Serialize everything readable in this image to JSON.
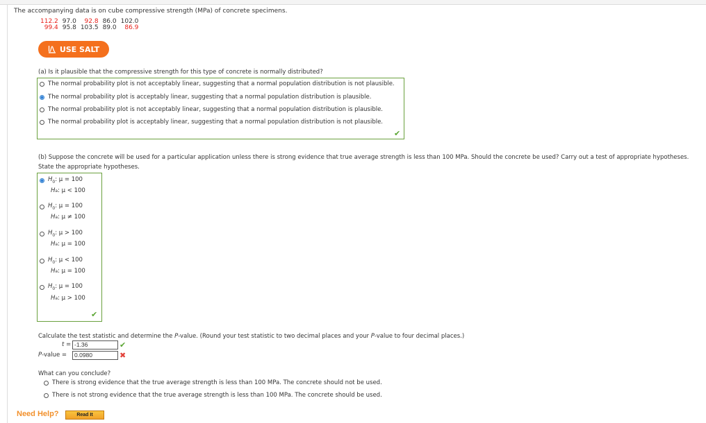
{
  "intro": "The accompanying data is on cube compressive strength (MPa) of concrete specimens.",
  "data_table": {
    "rows": [
      [
        {
          "v": "112.2",
          "c": "red"
        },
        {
          "v": "97.0",
          "c": "blk"
        },
        {
          "v": "92.8",
          "c": "red"
        },
        {
          "v": "86.0",
          "c": "blk"
        },
        {
          "v": "102.0",
          "c": "blk"
        }
      ],
      [
        {
          "v": "99.4",
          "c": "red"
        },
        {
          "v": "95.8",
          "c": "blk"
        },
        {
          "v": "103.5",
          "c": "blk"
        },
        {
          "v": "89.0",
          "c": "blk"
        },
        {
          "v": "86.9",
          "c": "red"
        }
      ]
    ]
  },
  "salt_button": {
    "label": "USE SALT",
    "icon": "salt-distribution-icon"
  },
  "part_a": {
    "question": "(a) Is it plausible that the compressive strength for this type of concrete is normally distributed?",
    "options": [
      {
        "label": "The normal probability plot is not acceptably linear, suggesting that a normal population distribution is not plausible.",
        "selected": false
      },
      {
        "label": "The normal probability plot is acceptably linear, suggesting that a normal population distribution is plausible.",
        "selected": true
      },
      {
        "label": "The normal probability plot is not acceptably linear, suggesting that a normal population distribution is plausible.",
        "selected": false
      },
      {
        "label": "The normal probability plot is acceptably linear, suggesting that a normal population distribution is not plausible.",
        "selected": false
      }
    ],
    "status": "correct"
  },
  "part_b": {
    "question": "(b) Suppose the concrete will be used for a particular application unless there is strong evidence that true average strength is less than 100 MPa. Should the concrete be used? Carry out a test of appropriate hypotheses.",
    "prompt": "State the appropriate hypotheses.",
    "hypotheses": [
      {
        "h0": ": μ = 100",
        "ha": ": μ < 100",
        "selected": true
      },
      {
        "h0": ": μ = 100",
        "ha": ": μ ≠ 100",
        "selected": false
      },
      {
        "h0": ": μ > 100",
        "ha": ": μ = 100",
        "selected": false
      },
      {
        "h0": ": μ < 100",
        "ha": ": μ = 100",
        "selected": false
      },
      {
        "h0": ": μ = 100",
        "ha": ": μ > 100",
        "selected": false
      }
    ],
    "h0_label": "H",
    "h0_sub": "0",
    "ha_label": "H",
    "ha_sub": "a",
    "status": "correct"
  },
  "calc": {
    "prompt_pre": "Calculate the test statistic and determine the ",
    "prompt_p": "P",
    "prompt_post": "-value. (Round your test statistic to two decimal places and your ",
    "prompt_p2": "P",
    "prompt_post2": "-value to four decimal places.)",
    "t_label": "t",
    "eq": " = ",
    "t_value": "-1.36",
    "t_status": "correct",
    "p_label_i": "P",
    "p_label": "-value",
    "p_value": "0.0980",
    "p_status": "incorrect"
  },
  "conclude": {
    "question": "What can you conclude?",
    "options": [
      {
        "label": "There is strong evidence that the true average strength is less than 100 MPa. The concrete should not be used.",
        "selected": false
      },
      {
        "label": "There is not strong evidence that the true average strength is less than 100 MPa. The concrete should be used.",
        "selected": false
      }
    ]
  },
  "help": {
    "label": "Need Help?",
    "read_it": "Read It"
  },
  "icons": {
    "check": "✔",
    "cross": "✖"
  }
}
